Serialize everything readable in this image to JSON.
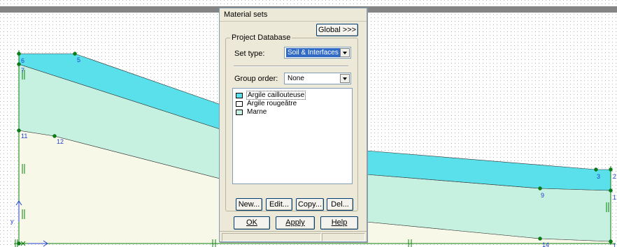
{
  "canvas": {
    "nodes": [
      {
        "label": "6"
      },
      {
        "label": "5"
      },
      {
        "label": "7"
      },
      {
        "label": "11"
      },
      {
        "label": "12"
      },
      {
        "label": "3"
      },
      {
        "label": "2"
      },
      {
        "label": "9"
      },
      {
        "label": "1"
      },
      {
        "label": "14"
      },
      {
        "label": "1"
      }
    ],
    "axis_label": "y",
    "colors": {
      "top_layer": "#5ae0ea",
      "middle_layer": "#c6f1e1",
      "bottom_layer": "#f8f8e9",
      "grid_dot": "#b7b7b7",
      "boundary": "#0a7f0a",
      "header_bar": "#858585"
    }
  },
  "dialog": {
    "title": "Material sets",
    "global_button": "Global >>>",
    "group_caption": "Project Database",
    "set_type_label": "Set type:",
    "set_type_value": "Soil & Interfaces",
    "group_order_label": "Group order:",
    "group_order_value": "None",
    "materials": [
      {
        "name": "Argile caillouteuse",
        "color": "#5ae0ea"
      },
      {
        "name": "Argile rougeâtre",
        "color": "#ffffff"
      },
      {
        "name": "Marne",
        "color": "#c6f1e1"
      }
    ],
    "buttons": {
      "new": "New...",
      "edit": "Edit...",
      "copy": "Copy...",
      "del": "Del...",
      "ok": "OK",
      "apply": "Apply",
      "help": "Help"
    }
  }
}
